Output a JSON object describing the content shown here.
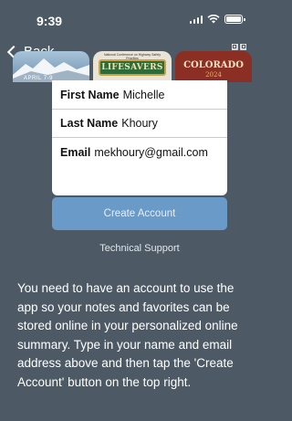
{
  "status_bar": {
    "time": "9:39"
  },
  "nav": {
    "back_label": "Back",
    "qr_icon": "qr-code-icon"
  },
  "banner": {
    "left_panel_text": "APRIL 7-9",
    "middle_panel_subtext": "National Conference on Highway Safety Priorities",
    "middle_panel_title": "LIFESAVERS",
    "right_panel_title": "COLORADO",
    "right_panel_year": "2024"
  },
  "form": {
    "first_name_label": "First Name",
    "first_name_value": "Michelle",
    "last_name_label": "Last Name",
    "last_name_value": "Khoury",
    "email_label": "Email",
    "email_value": "mekhoury@gmail.com"
  },
  "create_account_label": "Create Account",
  "support_link_label": "Technical Support",
  "info_text": "You need to have an account to use the app so your notes and favorites can be stored online in your personalized online summary. Type in your name and email address above and then tap the 'Create Account' button on the top right.",
  "colors": {
    "background": "#4d5a66",
    "button": "#6a9ac7",
    "card": "#ffffff"
  }
}
